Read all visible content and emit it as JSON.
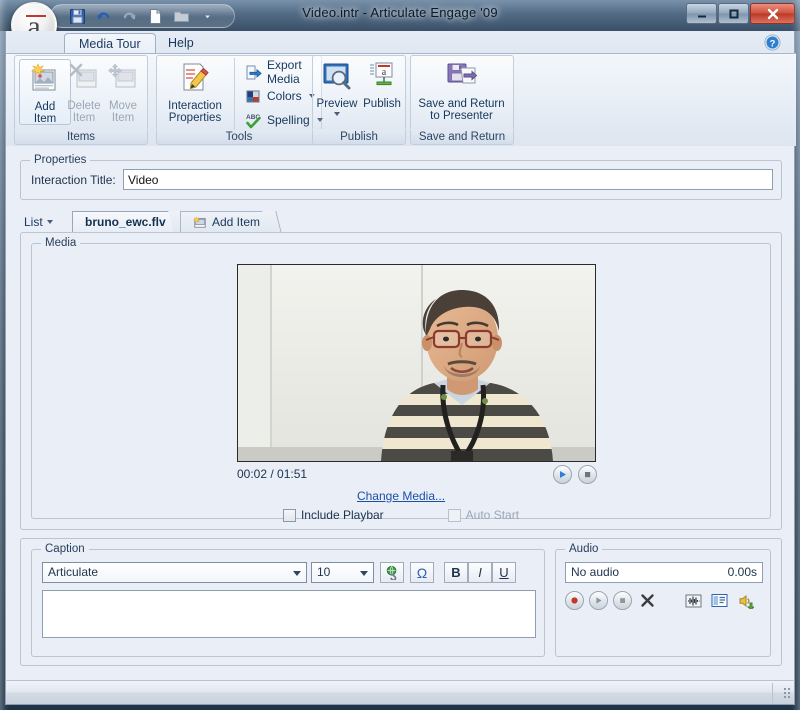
{
  "window": {
    "title": "Video.intr -  Articulate Engage '09",
    "controls": {
      "minimize": "minimize-button",
      "maximize": "maximize-button",
      "close": "close-button"
    }
  },
  "quick_access": {
    "items": [
      {
        "name": "save-icon",
        "label": "Save",
        "enabled": true
      },
      {
        "name": "undo-icon",
        "label": "Undo",
        "enabled": true
      },
      {
        "name": "redo-icon",
        "label": "Redo",
        "enabled": false
      },
      {
        "name": "new-icon",
        "label": "New",
        "enabled": true
      },
      {
        "name": "open-folder-icon",
        "label": "Open",
        "enabled": false
      },
      {
        "name": "customize-qat-icon",
        "label": "Customize Quick Access Toolbar",
        "enabled": true
      }
    ]
  },
  "ribbon": {
    "tabs": [
      {
        "label": "Media Tour",
        "active": true
      },
      {
        "label": "Help",
        "active": false
      }
    ],
    "help_icon": "help-icon",
    "groups": [
      {
        "label": "Items",
        "buttons": [
          {
            "label": "Add\nItem",
            "enabled": true,
            "icon": "add-item-icon"
          },
          {
            "label": "Delete\nItem",
            "enabled": false,
            "icon": "delete-item-icon"
          },
          {
            "label": "Move\nItem",
            "enabled": false,
            "icon": "move-item-icon",
            "has_caret": true
          }
        ]
      },
      {
        "label": "Tools",
        "big_buttons": [
          {
            "label": "Interaction\nProperties",
            "icon": "interaction-properties-icon"
          }
        ],
        "small_buttons": [
          {
            "label": "Export Media",
            "icon": "export-media-icon",
            "has_caret": false
          },
          {
            "label": "Colors",
            "icon": "colors-icon",
            "has_caret": true
          },
          {
            "label": "Spelling",
            "icon": "spelling-icon",
            "has_caret": true
          }
        ]
      },
      {
        "label": "Publish",
        "buttons": [
          {
            "label": "Preview",
            "icon": "preview-icon",
            "has_caret": true
          },
          {
            "label": "Publish",
            "icon": "publish-icon",
            "has_caret": false
          }
        ]
      },
      {
        "label": "Save and Return",
        "buttons": [
          {
            "label": "Save and Return\nto Presenter",
            "icon": "save-return-icon"
          }
        ]
      }
    ]
  },
  "properties": {
    "legend": "Properties",
    "title_label": "Interaction Title:",
    "title_value": "Video",
    "title_placeholder": "Interaction title"
  },
  "item_tabs": {
    "list_label": "List",
    "tabs": [
      {
        "label": "bruno_ewc.flv",
        "active": true,
        "icon": null
      },
      {
        "label": "Add Item",
        "active": false,
        "icon": "add-item-small-icon"
      }
    ]
  },
  "media": {
    "legend": "Media",
    "time_display": "00:02 / 01:51",
    "current_time": "00:02",
    "duration": "01:51",
    "play_button": "play-button",
    "stop_button": "stop-button",
    "change_media_link": "Change Media...",
    "include_playbar": {
      "label": "Include Playbar",
      "checked": false,
      "enabled": true
    },
    "auto_start": {
      "label": "Auto Start",
      "checked": false,
      "enabled": false
    }
  },
  "caption": {
    "legend": "Caption",
    "font_name": "Articulate",
    "font_size": "10",
    "hyperlink_button": "hyperlink-icon",
    "symbol_button": "omega-symbol-icon",
    "bold_button": "B",
    "italic_button": "I",
    "underline_button": "U",
    "text_value": "",
    "text_placeholder": ""
  },
  "audio": {
    "legend": "Audio",
    "status": "No audio",
    "duration": "0.00s",
    "buttons": [
      {
        "name": "record-audio-button",
        "label": "Record"
      },
      {
        "name": "play-audio-button",
        "label": "Play"
      },
      {
        "name": "stop-audio-button",
        "label": "Stop"
      },
      {
        "name": "delete-audio-button",
        "label": "Delete"
      },
      {
        "name": "edit-audio-button",
        "label": "Edit Audio"
      },
      {
        "name": "audio-properties-button",
        "label": "Audio Properties"
      },
      {
        "name": "import-audio-button",
        "label": "Import Audio"
      }
    ]
  },
  "statusbar": {
    "text": ""
  },
  "colors": {
    "accent": "#1b4fa8",
    "window_frame": "#3e5468",
    "panel_bg": "#eaeef6",
    "close_button": "#d2503c",
    "record_red": "#c0392b"
  }
}
